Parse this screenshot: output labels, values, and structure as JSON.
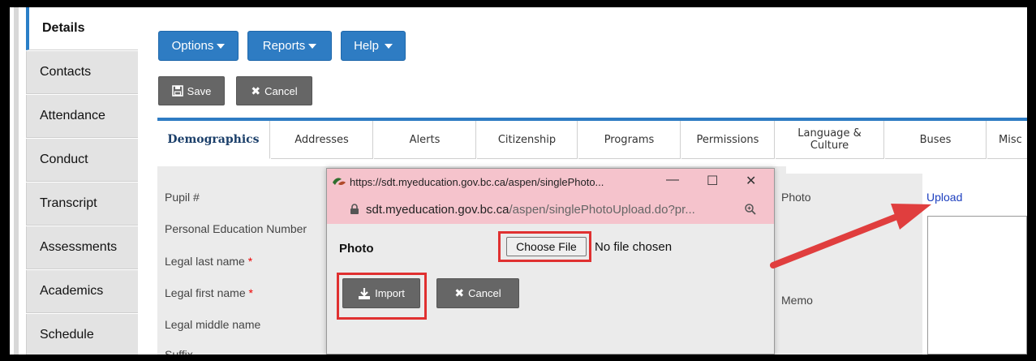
{
  "sidebar": {
    "items": [
      {
        "label": "Details",
        "active": true
      },
      {
        "label": "Contacts"
      },
      {
        "label": "Attendance"
      },
      {
        "label": "Conduct"
      },
      {
        "label": "Transcript"
      },
      {
        "label": "Assessments"
      },
      {
        "label": "Academics"
      },
      {
        "label": "Schedule"
      }
    ]
  },
  "toolbar": {
    "options_label": "Options",
    "reports_label": "Reports",
    "help_label": "Help",
    "save_label": "Save",
    "cancel_label": "Cancel"
  },
  "tabs": {
    "demographics": "Demographics",
    "addresses": "Addresses",
    "alerts": "Alerts",
    "citizenship": "Citizenship",
    "programs": "Programs",
    "permissions": "Permissions",
    "language_line1": "Language &",
    "language_line2": "Culture",
    "buses": "Buses",
    "misc": "Misc"
  },
  "form": {
    "pupil_number": "Pupil #",
    "pen": "Personal Education Number",
    "legal_last_name": "Legal last name",
    "legal_first_name": "Legal first name",
    "legal_middle_name": "Legal middle name",
    "suffix": "Suffix",
    "required_mark": "*"
  },
  "right_panel": {
    "photo_label": "Photo",
    "memo_label": "Memo",
    "upload_link": "Upload"
  },
  "popup": {
    "title": "https://sdt.myeducation.gov.bc.ca/aspen/singlePhoto...",
    "url_domain": "sdt.myeducation.gov.bc.ca",
    "url_path": "/aspen/singlePhotoUpload.do?pr...",
    "photo_label": "Photo",
    "choose_file_label": "Choose File",
    "no_file_text": "No file chosen",
    "import_label": "Import",
    "cancel_label": "Cancel"
  },
  "colors": {
    "accent_blue": "#2e7cc3",
    "button_dark": "#666666",
    "popup_titlebar": "#f5c3cc",
    "highlight_red": "#e03030"
  }
}
